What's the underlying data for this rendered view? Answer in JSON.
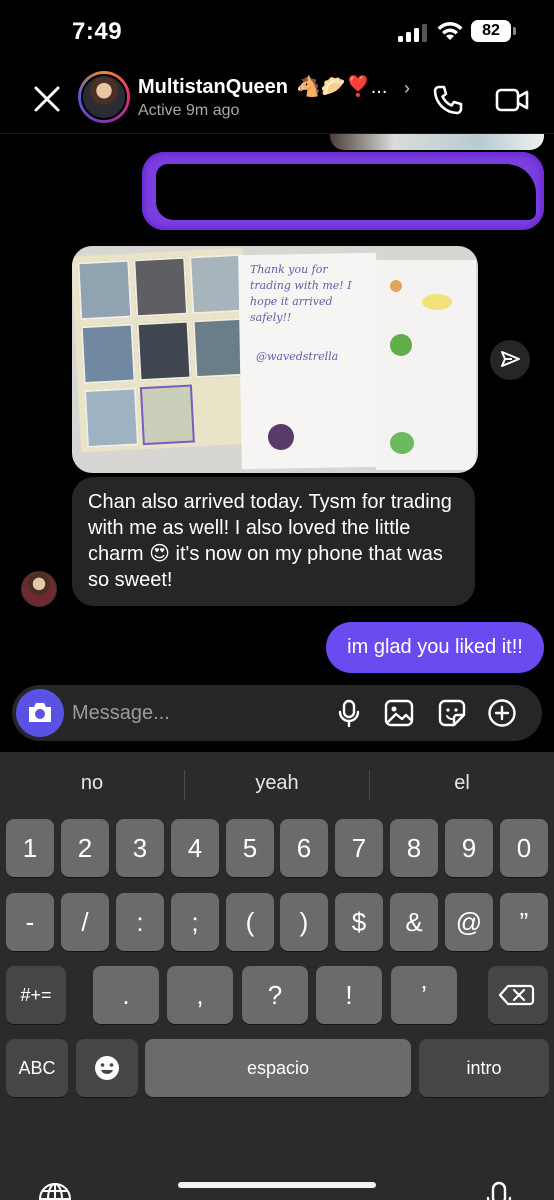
{
  "status_bar": {
    "time": "7:49",
    "battery": "82"
  },
  "header": {
    "contact_name": "MultistanQueen",
    "name_emojis": "🐴🥟❣️...",
    "chevron": "›",
    "status": "Active 9m ago"
  },
  "chat": {
    "photo_note": "Thank you for trading with me! I hope it arrived safely!!",
    "photo_handle": "@wavedstrella",
    "received_message": "Chan also arrived today. Tysm for trading with me as well! I also loved the little charm 😍 it's now on my phone that was so sweet!",
    "sent_message": "im glad you liked it!!"
  },
  "composer": {
    "placeholder": "Message..."
  },
  "keyboard": {
    "suggestions": [
      "no",
      "yeah",
      "el"
    ],
    "row1": [
      "1",
      "2",
      "3",
      "4",
      "5",
      "6",
      "7",
      "8",
      "9",
      "0"
    ],
    "row2": [
      "-",
      "/",
      ":",
      ";",
      "(",
      ")",
      "$",
      "&",
      "@",
      "”"
    ],
    "row3_left": "#+=",
    "row3": [
      ".",
      ",",
      "?",
      "!",
      "’"
    ],
    "abc": "ABC",
    "space": "espacio",
    "return": "intro"
  },
  "colors": {
    "sent_bubble": "#6a4bf0",
    "received_bubble": "#262626",
    "camera_button": "#5b51e3"
  },
  "icons": [
    "close-icon",
    "phone-icon",
    "video-icon",
    "share-icon",
    "camera-icon",
    "microphone-icon",
    "gallery-icon",
    "sticker-icon",
    "plus-icon",
    "backspace-icon",
    "emoji-icon",
    "globe-icon",
    "dictation-icon"
  ]
}
